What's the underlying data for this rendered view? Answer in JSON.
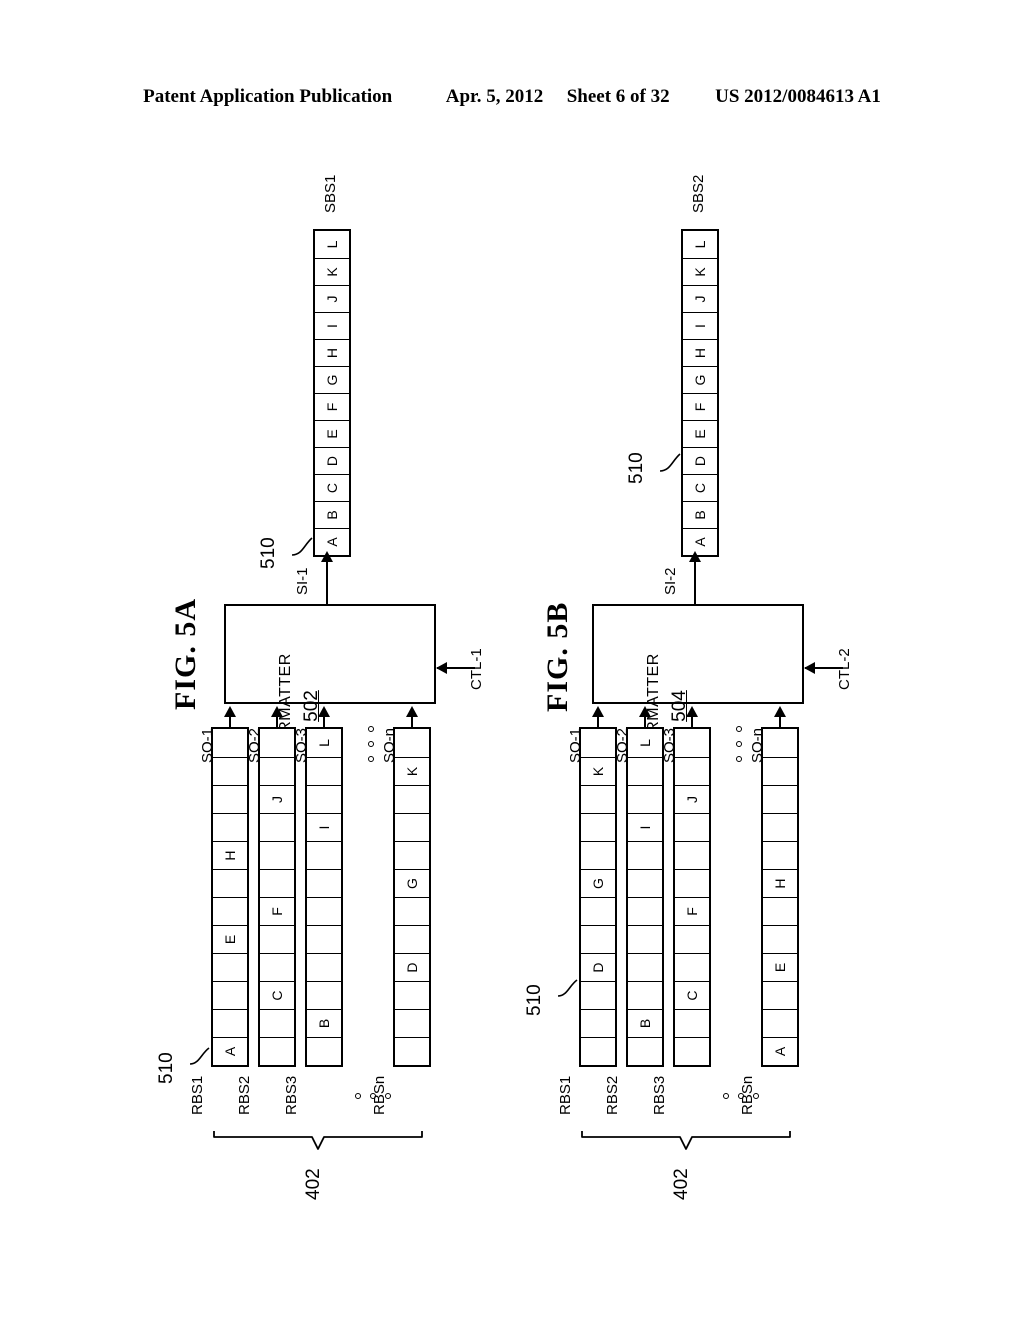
{
  "header": {
    "publication": "Patent Application Publication",
    "date": "Apr. 5, 2012",
    "sheet": "Sheet 6 of 32",
    "patent_number": "US 2012/0084613 A1"
  },
  "figures": [
    {
      "id": "fig5a",
      "title": "FIG. 5A",
      "formatter": {
        "title": "FORMATTER",
        "number": "502"
      },
      "control_label": "CTL-1",
      "stream_out_label": "SI-1",
      "output_buffer": {
        "name": "SBS1",
        "ref": "510",
        "cells": [
          "A",
          "B",
          "C",
          "D",
          "E",
          "F",
          "G",
          "H",
          "I",
          "J",
          "K",
          "L"
        ]
      },
      "group_ref": "402",
      "row_ref": "510",
      "input_labels": [
        "SO-1",
        "SO-2",
        "SO-3",
        "SO-n"
      ],
      "row_buffers": [
        {
          "name": "RBS1",
          "cells": [
            "A",
            "",
            "",
            "",
            "E",
            "",
            "",
            "H",
            "",
            "",
            "",
            ""
          ]
        },
        {
          "name": "RBS2",
          "cells": [
            "",
            "",
            "C",
            "",
            "",
            "F",
            "",
            "",
            "",
            "J",
            "",
            ""
          ]
        },
        {
          "name": "RBS3",
          "cells": [
            "",
            "B",
            "",
            "",
            "",
            "",
            "",
            "",
            "I",
            "",
            "",
            "L"
          ]
        },
        {
          "name": "RBSn",
          "cells": [
            "",
            "",
            "",
            "D",
            "",
            "",
            "G",
            "",
            "",
            "",
            "K",
            ""
          ]
        }
      ]
    },
    {
      "id": "fig5b",
      "title": "FIG. 5B",
      "formatter": {
        "title": "FORMATTER",
        "number": "504"
      },
      "control_label": "CTL-2",
      "stream_out_label": "SI-2",
      "output_buffer": {
        "name": "SBS2",
        "ref": "510",
        "cells": [
          "A",
          "B",
          "C",
          "D",
          "E",
          "F",
          "G",
          "H",
          "I",
          "J",
          "K",
          "L"
        ]
      },
      "group_ref": "402",
      "row_ref": "510",
      "input_labels": [
        "SO-1",
        "SO-2",
        "SO-3",
        "SO-n"
      ],
      "row_buffers": [
        {
          "name": "RBS1",
          "cells": [
            "",
            "",
            "",
            "D",
            "",
            "",
            "G",
            "",
            "",
            "",
            "K",
            ""
          ]
        },
        {
          "name": "RBS2",
          "cells": [
            "",
            "B",
            "",
            "",
            "",
            "",
            "",
            "",
            "I",
            "",
            "",
            "L"
          ]
        },
        {
          "name": "RBS3",
          "cells": [
            "",
            "",
            "C",
            "",
            "",
            "F",
            "",
            "",
            "",
            "J",
            "",
            ""
          ]
        },
        {
          "name": "RBSn",
          "cells": [
            "A",
            "",
            "",
            "E",
            "",
            "",
            "H",
            "",
            "",
            "",
            "",
            ""
          ]
        }
      ]
    }
  ]
}
